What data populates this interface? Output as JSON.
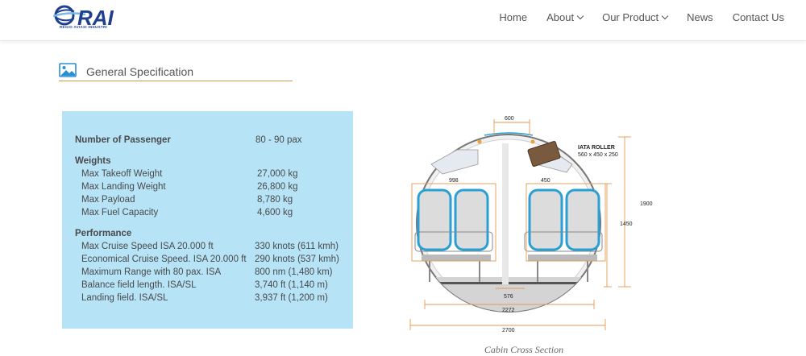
{
  "header": {
    "logo_text": "RAI",
    "logo_tagline": "REGIO AVIASI INDUSTRI",
    "nav": [
      {
        "label": "Home",
        "has_dropdown": false
      },
      {
        "label": "About",
        "has_dropdown": true
      },
      {
        "label": "Our Product",
        "has_dropdown": true
      },
      {
        "label": "News",
        "has_dropdown": false
      },
      {
        "label": "Contact Us",
        "has_dropdown": false
      }
    ]
  },
  "section": {
    "icon": "image-icon",
    "title": "General Specification"
  },
  "specs": {
    "passenger": {
      "label": "Number of Passenger",
      "value": "80 - 90 pax"
    },
    "weights_title": "Weights",
    "weights": [
      {
        "label": "Max Takeoff Weight",
        "value": "27,000 kg"
      },
      {
        "label": "Max Landing Weight",
        "value": "26,800 kg"
      },
      {
        "label": "Max Payload",
        "value": "8,780 kg"
      },
      {
        "label": "Max Fuel Capacity",
        "value": "4,600 kg"
      }
    ],
    "performance_title": "Performance",
    "performance": [
      {
        "label": "Max Cruise Speed ISA 20.000 ft",
        "value": "330 knots (611 kmh)"
      },
      {
        "label": "Economical Cruise Speed. ISA 20.000 ft",
        "value": "290 knots (537 kmh)"
      },
      {
        "label": "Maximum Range with 80 pax. ISA",
        "value": "800 nm (1,480 km)"
      },
      {
        "label": "Balance field length. ISA/SL",
        "value": "3,740 ft  (1,140 m)"
      },
      {
        "label": "Landing field. ISA/SL",
        "value": "3,937 ft  (1,200 m)"
      }
    ]
  },
  "diagram": {
    "caption": "Cabin Cross Section",
    "roller_label": "IATA ROLLER",
    "roller_size": "560 x 450 x 250",
    "dims": {
      "top": "600",
      "left_seat": "998",
      "right_seat": "450",
      "height_total": "1900",
      "height_inner": "1450",
      "aisle": "576",
      "floor": "2272",
      "width": "2700"
    }
  },
  "colors": {
    "spec_bg": "#b6e3f6",
    "accent_line": "#c79b4b",
    "logo_blue": "#1f3f8f",
    "seat_blue": "#2a9fd6",
    "dim_orange": "#e59a52"
  }
}
